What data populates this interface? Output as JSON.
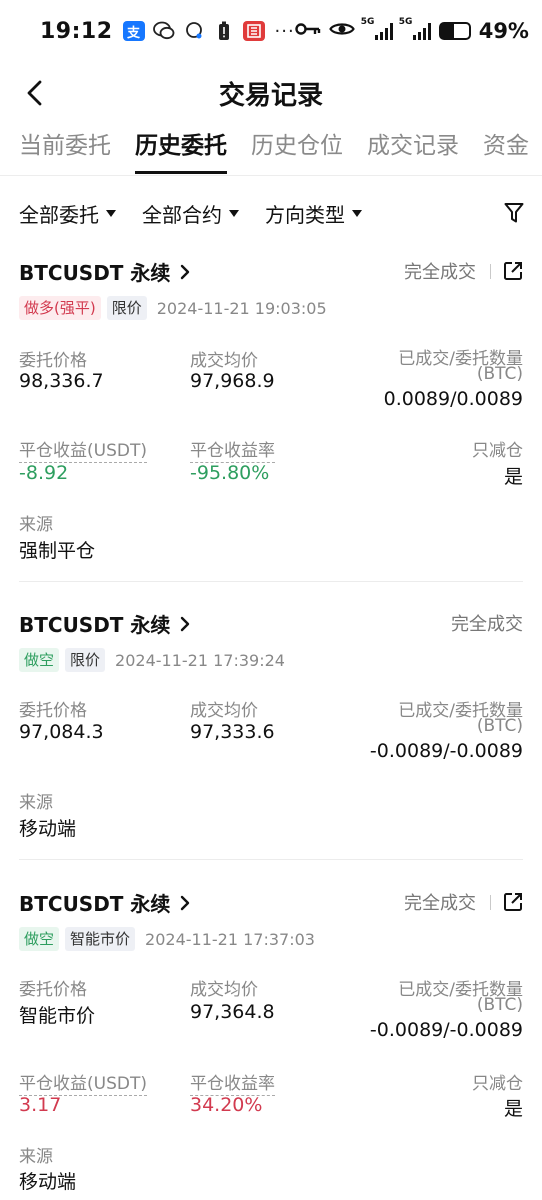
{
  "status_bar": {
    "time": "19:12",
    "battery": "49%",
    "signal1": "5G",
    "signal2": "5G"
  },
  "nav": {
    "title": "交易记录"
  },
  "tabs": [
    {
      "label": "当前委托",
      "active": false
    },
    {
      "label": "历史委托",
      "active": true
    },
    {
      "label": "历史仓位",
      "active": false
    },
    {
      "label": "成交记录",
      "active": false
    },
    {
      "label": "资金",
      "active": false
    }
  ],
  "filters": [
    "全部委托",
    "全部合约",
    "方向类型"
  ],
  "labels": {
    "order_price": "委托价格",
    "avg_price": "成交均价",
    "filled_qty": "已成交/委托数量",
    "qty_unit": "(BTC)",
    "close_pnl": "平仓收益(USDT)",
    "close_pnl_rate": "平仓收益率",
    "reduce_only": "只减仓",
    "source": "来源"
  },
  "orders": [
    {
      "symbol": "BTCUSDT 永续",
      "status": "完全成交",
      "side_tag": "做多(强平)",
      "type_tag": "限价",
      "time": "2024-11-21 19:03:05",
      "order_price": "98,336.7",
      "avg_price": "97,968.9",
      "filled": "0.0089/0.0089",
      "pnl": "-8.92",
      "pnl_rate": "-95.80%",
      "reduce_only": "是",
      "source": "强制平仓"
    },
    {
      "symbol": "BTCUSDT 永续",
      "status": "完全成交",
      "side_tag": "做空",
      "type_tag": "限价",
      "time": "2024-11-21 17:39:24",
      "order_price": "97,084.3",
      "avg_price": "97,333.6",
      "filled": "-0.0089/-0.0089",
      "source": "移动端"
    },
    {
      "symbol": "BTCUSDT 永续",
      "status": "完全成交",
      "side_tag": "做空",
      "type_tag": "智能市价",
      "time": "2024-11-21 17:37:03",
      "order_price": "智能市价",
      "avg_price": "97,364.8",
      "filled": "-0.0089/-0.0089",
      "pnl": "3.17",
      "pnl_rate": "34.20%",
      "reduce_only": "是",
      "source": "移动端"
    }
  ],
  "colors": {
    "loss": "#2e9e5f",
    "profit": "#d23a4f"
  }
}
